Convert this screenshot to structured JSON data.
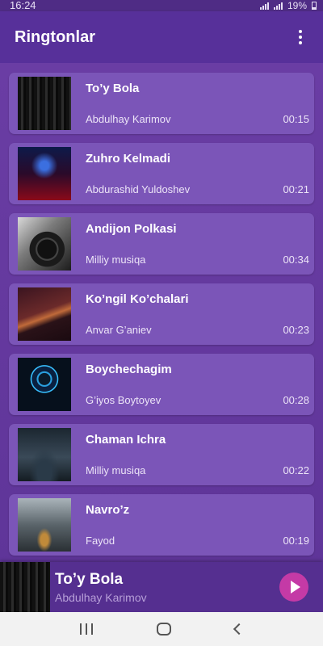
{
  "status": {
    "time": "16:24",
    "battery": "19%"
  },
  "app": {
    "title": "Ringtonlar",
    "menu_icon": "more-vert-icon"
  },
  "tracks": [
    {
      "title": "To’y Bola",
      "artist": "Abdulhay Karimov",
      "duration": "00:15"
    },
    {
      "title": "Zuhro Kelmadi",
      "artist": "Abdurashid Yuldoshev",
      "duration": "00:21"
    },
    {
      "title": "Andijon Polkasi",
      "artist": "Milliy musiqa",
      "duration": "00:34"
    },
    {
      "title": "Ko’ngil Ko’chalari",
      "artist": "Anvar G’aniev",
      "duration": "00:23"
    },
    {
      "title": "Boychechagim",
      "artist": "G’iyos Boytoyev",
      "duration": "00:28"
    },
    {
      "title": "Chaman Ichra",
      "artist": "Milliy musiqa",
      "duration": "00:22"
    },
    {
      "title": "Navro’z",
      "artist": "Fayod",
      "duration": "00:19"
    }
  ],
  "player": {
    "title": "To’y Bola",
    "artist": "Abdulhay Karimov",
    "play_icon": "play-icon"
  },
  "colors": {
    "background": "#6b3fa6",
    "card": "#7b55b8",
    "app_bar": "#57309a",
    "play_button": "#c43aa6"
  }
}
